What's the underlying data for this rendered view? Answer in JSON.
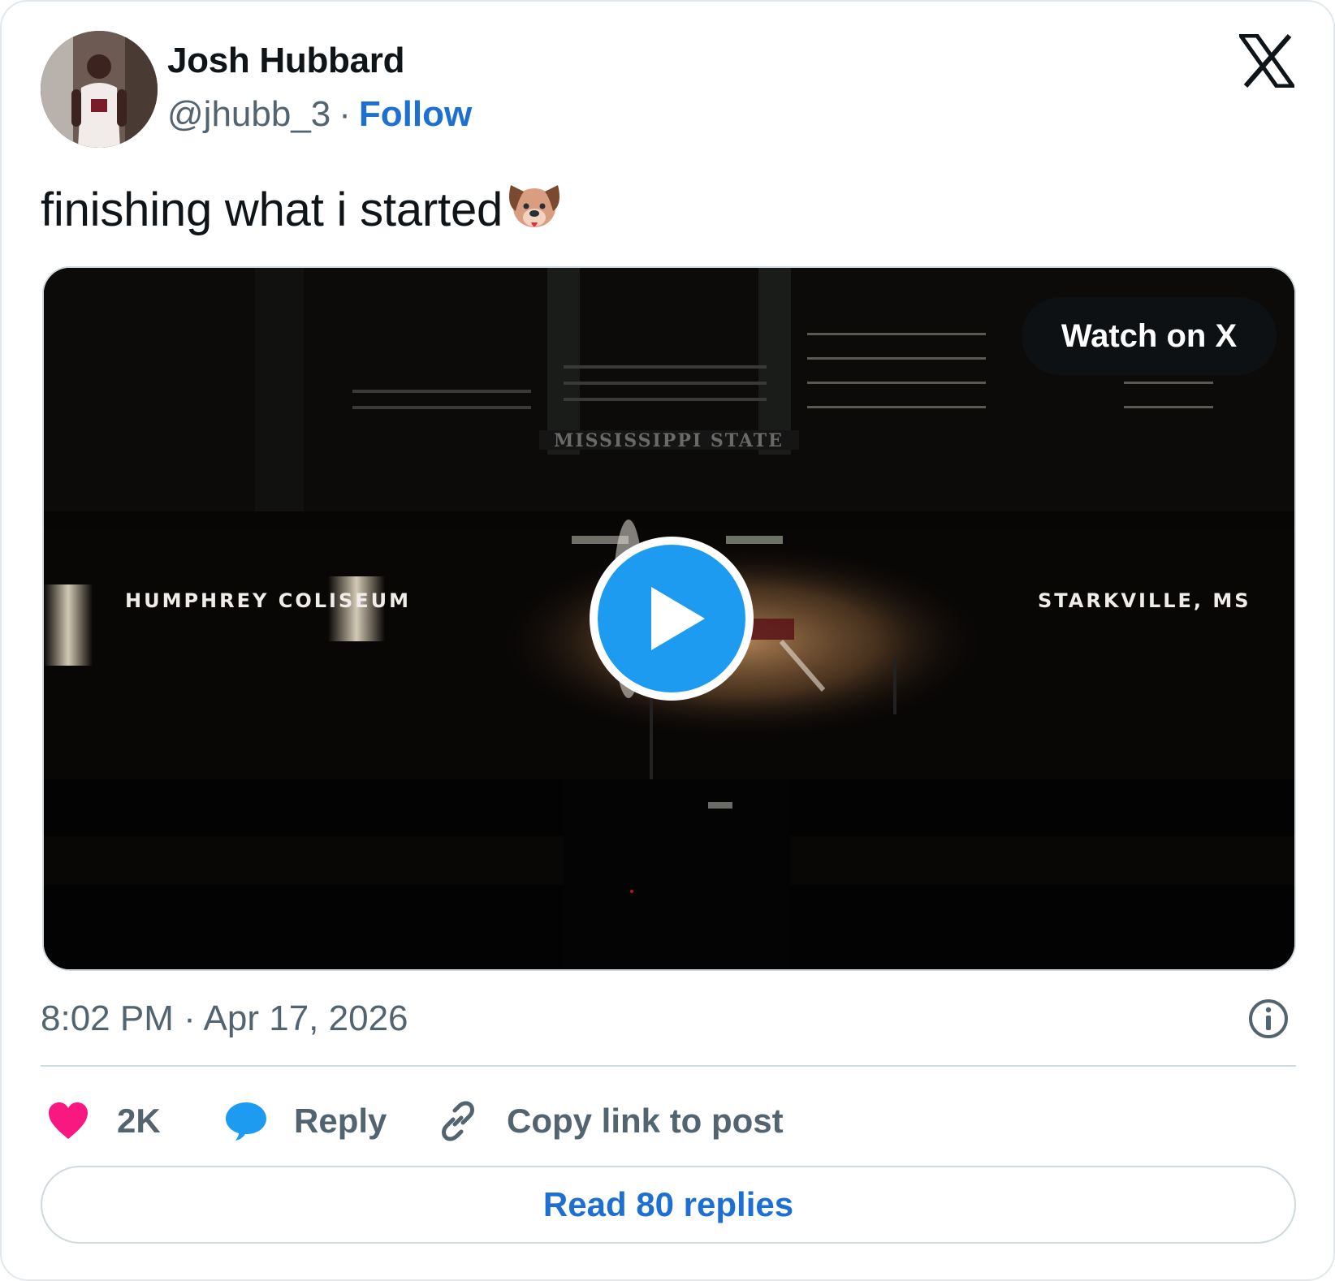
{
  "author": {
    "name": "Josh Hubbard",
    "handle": "@jhubb_3",
    "separator": "·",
    "follow_label": "Follow"
  },
  "platform_icon": "x-logo-icon",
  "tweet": {
    "text": "finishing what i started",
    "emoji_icon": "dog-face-icon"
  },
  "media": {
    "watch_label": "Watch on X",
    "overlay_left": "HUMPHREY COLISEUM",
    "overlay_right": "STARKVILLE, MS",
    "banner_text": "MISSISSIPPI STATE",
    "play_icon": "play-icon"
  },
  "meta": {
    "timestamp": "8:02 PM · Apr 17, 2026",
    "info_icon": "info-icon"
  },
  "actions": {
    "like_count": "2K",
    "reply_label": "Reply",
    "copy_label": "Copy link to post"
  },
  "read_replies_label": "Read 80 replies",
  "colors": {
    "accent": "#1d9bf0",
    "link": "#1d6fd2",
    "like": "#f91880",
    "muted": "#536471"
  }
}
